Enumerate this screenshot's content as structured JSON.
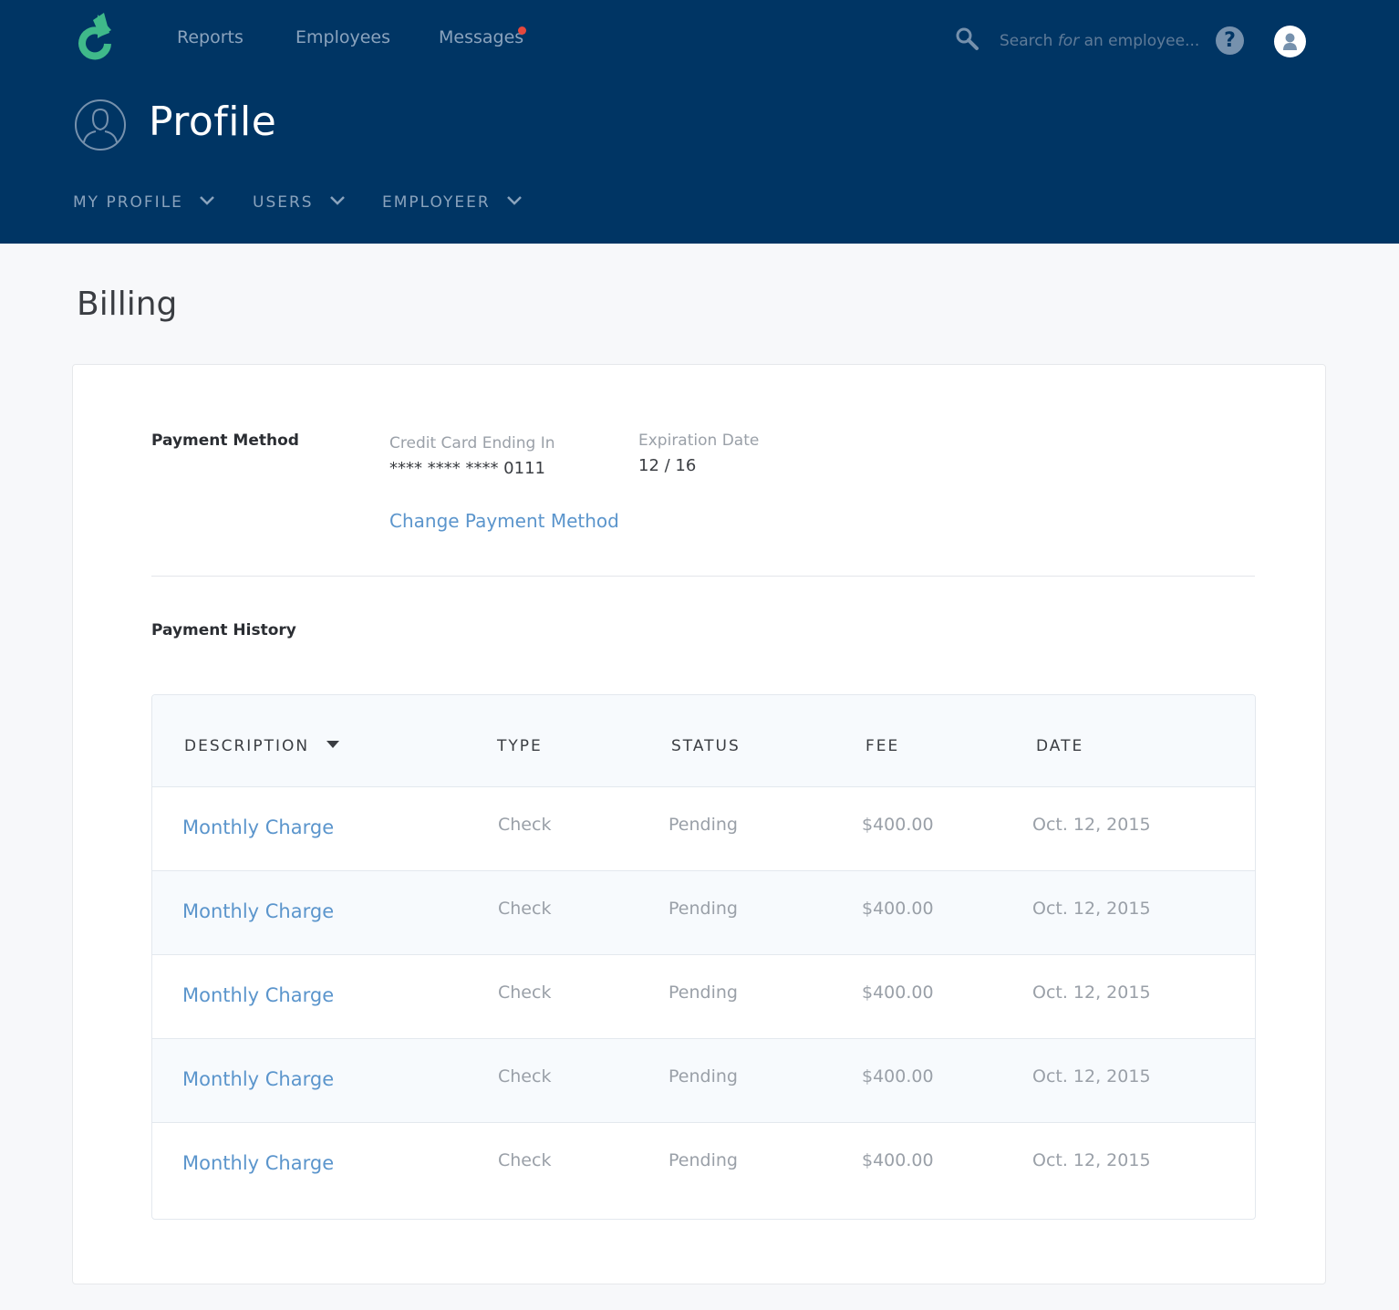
{
  "nav": {
    "links": [
      "Reports",
      "Employees",
      "Messages"
    ],
    "search_placeholder_before": "Search ",
    "search_placeholder_em": "for",
    "search_placeholder_after": " an employee...",
    "help_label": "?"
  },
  "header": {
    "title": "Profile",
    "subnav": [
      "MY PROFILE",
      "USERS",
      "EMPLOYEER"
    ]
  },
  "billing": {
    "title": "Billing",
    "payment_method": {
      "label": "Payment Method",
      "card_label": "Credit Card Ending In",
      "card_value": "**** **** **** 0111",
      "expiration_label": "Expiration Date",
      "expiration_value": "12 / 16",
      "change_link": "Change Payment Method"
    },
    "payment_history": {
      "label": "Payment History",
      "columns": [
        "DESCRIPTION",
        "TYPE",
        "STATUS",
        "FEE",
        "DATE"
      ],
      "rows": [
        {
          "description": "Monthly Charge",
          "type": "Check",
          "status": "Pending",
          "fee": "$400.00",
          "date": "Oct. 12, 2015"
        },
        {
          "description": "Monthly Charge",
          "type": "Check",
          "status": "Pending",
          "fee": "$400.00",
          "date": "Oct. 12, 2015"
        },
        {
          "description": "Monthly Charge",
          "type": "Check",
          "status": "Pending",
          "fee": "$400.00",
          "date": "Oct. 12, 2015"
        },
        {
          "description": "Monthly Charge",
          "type": "Check",
          "status": "Pending",
          "fee": "$400.00",
          "date": "Oct. 12, 2015"
        },
        {
          "description": "Monthly Charge",
          "type": "Check",
          "status": "Pending",
          "fee": "$400.00",
          "date": "Oct. 12, 2015"
        }
      ]
    }
  },
  "colors": {
    "header_bg": "#003564",
    "accent_green": "#3fb98a",
    "link_blue": "#5b95cc",
    "notification_dot": "#e5483d"
  },
  "icons": {
    "logo": "refresh-arrow-logo",
    "search": "search-icon",
    "help": "help-icon",
    "avatar": "user-avatar-icon",
    "profile": "profile-icon",
    "chevron": "chevron-down-icon",
    "sort": "sort-caret-icon"
  }
}
